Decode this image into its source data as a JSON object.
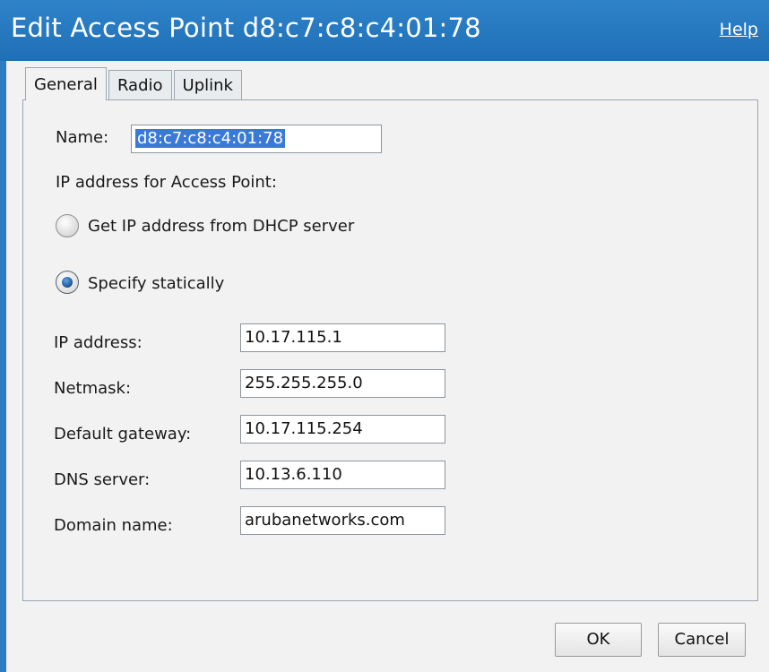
{
  "dialog": {
    "title": "Edit Access Point d8:c7:c8:c4:01:78",
    "help_label": "Help"
  },
  "tabs": [
    {
      "label": "General",
      "active": true
    },
    {
      "label": "Radio",
      "active": false
    },
    {
      "label": "Uplink",
      "active": false
    }
  ],
  "general": {
    "name_label": "Name:",
    "name_value": "d8:c7:c8:c4:01:78",
    "ip_section_label": "IP address for Access Point:",
    "dhcp_label": "Get IP address from DHCP server",
    "static_label": "Specify statically",
    "selected_mode": "static",
    "ip_label": "IP address:",
    "ip_value": "10.17.115.1",
    "netmask_label": "Netmask:",
    "netmask_value": "255.255.255.0",
    "gateway_label": "Default gateway:",
    "gateway_value": "10.17.115.254",
    "dns_label": "DNS server:",
    "dns_value": "10.13.6.110",
    "domain_label": "Domain name:",
    "domain_value": "arubanetworks.com"
  },
  "buttons": {
    "ok_label": "OK",
    "cancel_label": "Cancel"
  },
  "colors": {
    "titlebar": "#1e6fb6",
    "selection": "#3b79d6"
  }
}
